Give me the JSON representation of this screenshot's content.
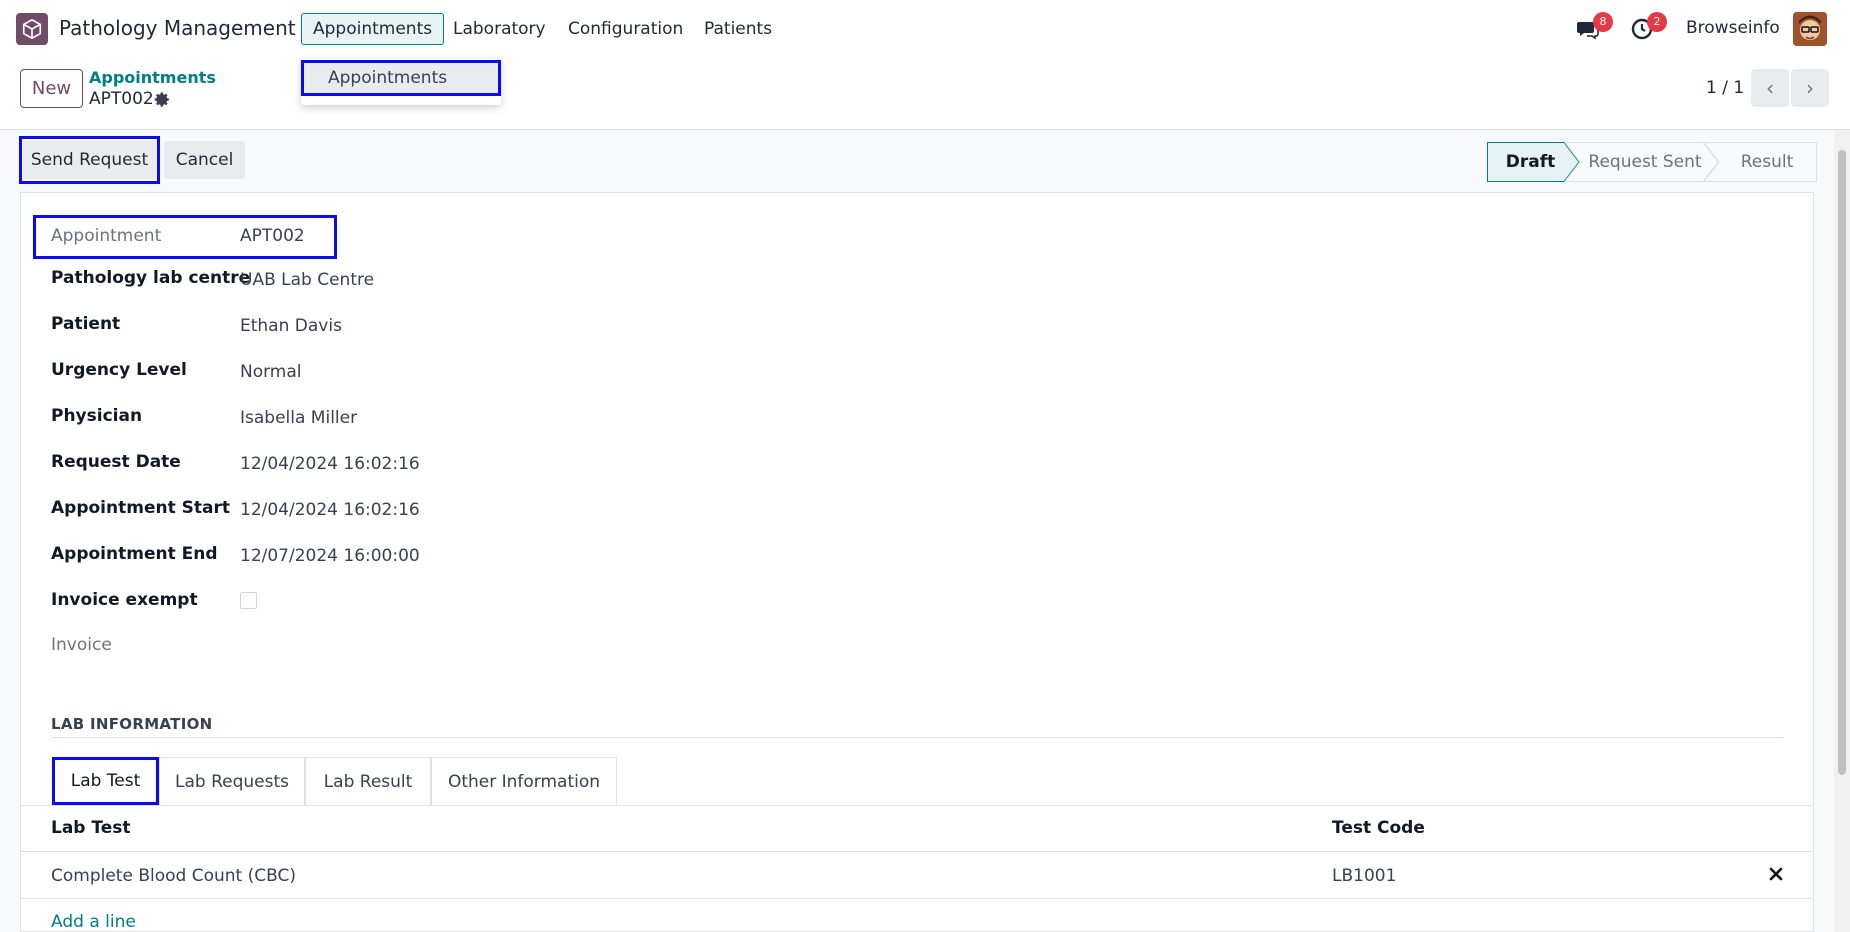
{
  "navbar": {
    "app_name": "Pathology Management",
    "menus": [
      "Appointments",
      "Laboratory",
      "Configuration",
      "Patients"
    ],
    "messages_badge": "8",
    "activities_badge": "2",
    "user_name": "Browseinfo"
  },
  "dropdown": {
    "items": [
      "Appointments"
    ]
  },
  "control_panel": {
    "new_label": "New",
    "breadcrumb": "Appointments",
    "record_name": "APT002",
    "pager": "1 / 1"
  },
  "status_bar": {
    "send_request": "Send Request",
    "cancel": "Cancel",
    "stages": [
      "Draft",
      "Request Sent",
      "Result"
    ],
    "current_stage": "Draft"
  },
  "form": {
    "fields": [
      {
        "label": "Appointment",
        "value": "APT002"
      },
      {
        "label": "Pathology lab centre",
        "value": "UAB Lab Centre"
      },
      {
        "label": "Patient",
        "value": "Ethan Davis"
      },
      {
        "label": "Urgency Level",
        "value": "Normal"
      },
      {
        "label": "Physician",
        "value": "Isabella Miller"
      },
      {
        "label": "Request Date",
        "value": "12/04/2024 16:02:16"
      },
      {
        "label": "Appointment Start",
        "value": "12/04/2024 16:02:16"
      },
      {
        "label": "Appointment End",
        "value": "12/07/2024 16:00:00"
      },
      {
        "label": "Invoice exempt",
        "value": ""
      },
      {
        "label": "Invoice",
        "value": ""
      }
    ],
    "invoice_exempt_checked": false
  },
  "lab_section": {
    "title": "LAB INFORMATION",
    "tabs": [
      "Lab Test",
      "Lab Requests",
      "Lab Result",
      "Other Information"
    ],
    "active_tab": "Lab Test",
    "columns": [
      "Lab Test",
      "Test Code"
    ],
    "rows": [
      {
        "lab_test": "Complete Blood Count (CBC)",
        "test_code": "LB1001"
      }
    ],
    "add_line": "Add a line"
  },
  "colors": {
    "brand": "#714b67",
    "accent": "#017e84",
    "highlight": "#0a0af5",
    "badge": "#e63946"
  }
}
